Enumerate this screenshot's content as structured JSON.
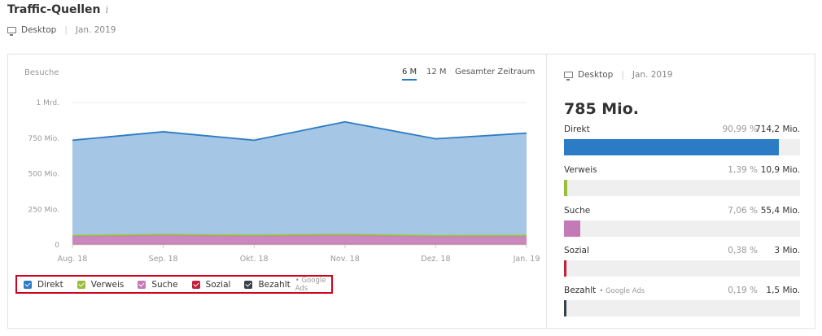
{
  "header": {
    "title": "Traffic-Quellen",
    "info_glyph": "i",
    "device": "Desktop",
    "date": "Jan. 2019"
  },
  "chart_panel": {
    "ylabel": "Besuche",
    "periods": [
      "6 M",
      "12 M",
      "Gesamter Zeitraum"
    ],
    "active_period": "6 M"
  },
  "chart_data": {
    "type": "area",
    "stacked": true,
    "categories": [
      "Aug. 18",
      "Sep. 18",
      "Okt. 18",
      "Nov. 18",
      "Dez. 18",
      "Jan. 19"
    ],
    "ylim": [
      0,
      1000000000
    ],
    "yticks": [
      0,
      250000000,
      500000000,
      750000000,
      1000000000
    ],
    "ytick_labels": [
      "0",
      "250 Mio.",
      "500 Mio.",
      "750 Mio.",
      "1 Mrd."
    ],
    "grid": true,
    "series": [
      {
        "name": "Bezahlt",
        "color": "#2e3a44",
        "values": [
          1500000,
          1500000,
          1500000,
          1500000,
          1500000,
          1500000
        ]
      },
      {
        "name": "Sozial",
        "color": "#c0392b",
        "values": [
          3000000,
          3000000,
          3000000,
          3000000,
          3000000,
          3000000
        ]
      },
      {
        "name": "Suche",
        "color": "#c57ab8",
        "values": [
          55000000,
          62000000,
          58000000,
          62000000,
          54000000,
          55400000
        ]
      },
      {
        "name": "Verweis",
        "color": "#9bbd3c",
        "values": [
          10500000,
          11000000,
          10500000,
          11500000,
          10500000,
          10900000
        ]
      },
      {
        "name": "Direkt",
        "color": "#2c7bc5",
        "values": [
          665000000,
          717000000,
          662000000,
          786000000,
          676000000,
          714200000
        ]
      }
    ]
  },
  "legend": [
    {
      "name": "Direkt",
      "color": "#2c7bc5"
    },
    {
      "name": "Verweis",
      "color": "#9bbd3c"
    },
    {
      "name": "Suche",
      "color": "#c57ab8"
    },
    {
      "name": "Sozial",
      "color": "#c0213b"
    },
    {
      "name": "Bezahlt",
      "color": "#37424c",
      "note": "Google Ads"
    }
  ],
  "right_panel": {
    "device": "Desktop",
    "date": "Jan. 2019",
    "total": "785 Mio.",
    "rows": [
      {
        "label": "Direkt",
        "pct": "90,99 %",
        "value": "714,2 Mio.",
        "share": 0.9099,
        "color": "#2c7bc5"
      },
      {
        "label": "Verweis",
        "pct": "1,39 %",
        "value": "10,9 Mio.",
        "share": 0.0139,
        "color": "#9bbd3c"
      },
      {
        "label": "Suche",
        "pct": "7,06 %",
        "value": "55,4 Mio.",
        "share": 0.0706,
        "color": "#c57ab8"
      },
      {
        "label": "Sozial",
        "pct": "0,38 %",
        "value": "3 Mio.",
        "share": 0.0038,
        "color": "#c0213b"
      },
      {
        "label": "Bezahlt",
        "note": "Google Ads",
        "pct": "0,19 %",
        "value": "1,5 Mio.",
        "share": 0.0019,
        "color": "#37424c"
      }
    ]
  }
}
